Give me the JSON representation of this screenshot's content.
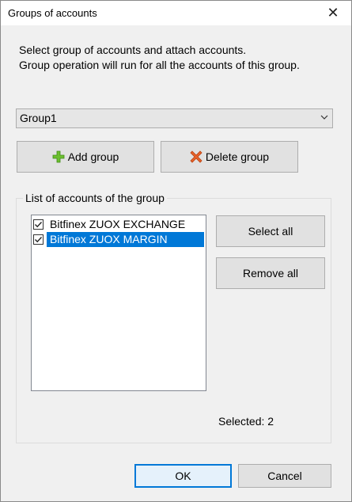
{
  "window": {
    "title": "Groups of accounts",
    "close_glyph": "✕"
  },
  "description": {
    "line1": "Select group of accounts and attach accounts.",
    "line2": "Group operation will run for all the accounts of this group."
  },
  "group_select": {
    "value": "Group1"
  },
  "buttons": {
    "add_group": "Add group",
    "delete_group": "Delete group",
    "select_all": "Select all",
    "remove_all": "Remove all",
    "ok": "OK",
    "cancel": "Cancel"
  },
  "accounts_box": {
    "label": "List of accounts of the group",
    "items": [
      {
        "label": "Bitfinex ZUOX EXCHANGE",
        "checked": true,
        "selected": false
      },
      {
        "label": "Bitfinex ZUOX MARGIN",
        "checked": true,
        "selected": true
      }
    ],
    "selected_text": "Selected: 2"
  },
  "colors": {
    "accent": "#0078d7",
    "add_icon": "#6cbf2f",
    "delete_icon": "#e8622a"
  }
}
